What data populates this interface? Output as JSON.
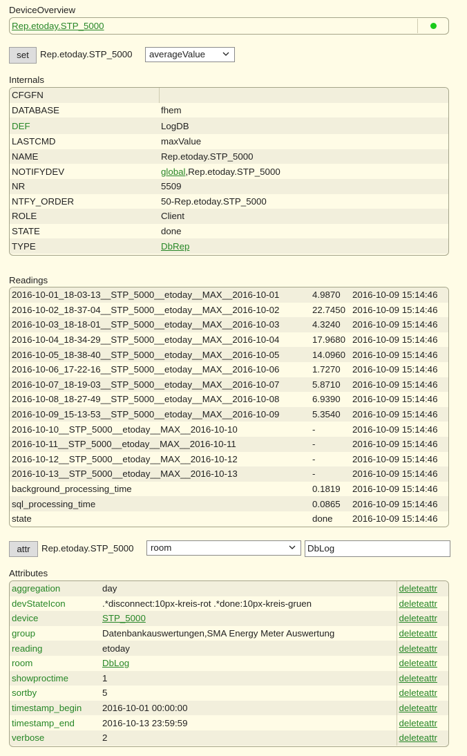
{
  "device_overview": {
    "title": "DeviceOverview",
    "device_link": "Rep.etoday.STP_5000",
    "status_color": "#1aca1a"
  },
  "set_row": {
    "button_label": "set",
    "device_name": "Rep.etoday.STP_5000",
    "selected_value": "averageValue"
  },
  "internals": {
    "title": "Internals",
    "rows": [
      {
        "key": "CFGFN",
        "value": ""
      },
      {
        "key": "DATABASE",
        "value": "fhem"
      },
      {
        "key": "DEF",
        "value": "LogDB"
      },
      {
        "key": "LASTCMD",
        "value": "maxValue"
      },
      {
        "key": "NAME",
        "value": "Rep.etoday.STP_5000"
      },
      {
        "key": "NOTIFYDEV",
        "value_link": "global",
        "value_rest": ",Rep.etoday.STP_5000"
      },
      {
        "key": "NR",
        "value": "5509"
      },
      {
        "key": "NTFY_ORDER",
        "value": "50-Rep.etoday.STP_5000"
      },
      {
        "key": "ROLE",
        "value": "Client"
      },
      {
        "key": "STATE",
        "value": "done"
      },
      {
        "key": "TYPE",
        "value_link": "DbRep"
      }
    ]
  },
  "readings": {
    "title": "Readings",
    "rows": [
      {
        "name": "2016-10-01_18-03-13__STP_5000__etoday__MAX__2016-10-01",
        "value": "4.9870",
        "time": "2016-10-09 15:14:46"
      },
      {
        "name": "2016-10-02_18-37-04__STP_5000__etoday__MAX__2016-10-02",
        "value": "22.7450",
        "time": "2016-10-09 15:14:46"
      },
      {
        "name": "2016-10-03_18-18-01__STP_5000__etoday__MAX__2016-10-03",
        "value": "4.3240",
        "time": "2016-10-09 15:14:46"
      },
      {
        "name": "2016-10-04_18-34-29__STP_5000__etoday__MAX__2016-10-04",
        "value": "17.9680",
        "time": "2016-10-09 15:14:46"
      },
      {
        "name": "2016-10-05_18-38-40__STP_5000__etoday__MAX__2016-10-05",
        "value": "14.0960",
        "time": "2016-10-09 15:14:46"
      },
      {
        "name": "2016-10-06_17-22-16__STP_5000__etoday__MAX__2016-10-06",
        "value": "1.7270",
        "time": "2016-10-09 15:14:46"
      },
      {
        "name": "2016-10-07_18-19-03__STP_5000__etoday__MAX__2016-10-07",
        "value": "5.8710",
        "time": "2016-10-09 15:14:46"
      },
      {
        "name": "2016-10-08_18-27-49__STP_5000__etoday__MAX__2016-10-08",
        "value": "6.9390",
        "time": "2016-10-09 15:14:46"
      },
      {
        "name": "2016-10-09_15-13-53__STP_5000__etoday__MAX__2016-10-09",
        "value": "5.3540",
        "time": "2016-10-09 15:14:46"
      },
      {
        "name": "2016-10-10__STP_5000__etoday__MAX__2016-10-10",
        "value": "-",
        "time": "2016-10-09 15:14:46"
      },
      {
        "name": "2016-10-11__STP_5000__etoday__MAX__2016-10-11",
        "value": "-",
        "time": "2016-10-09 15:14:46"
      },
      {
        "name": "2016-10-12__STP_5000__etoday__MAX__2016-10-12",
        "value": "-",
        "time": "2016-10-09 15:14:46"
      },
      {
        "name": "2016-10-13__STP_5000__etoday__MAX__2016-10-13",
        "value": "-",
        "time": "2016-10-09 15:14:46"
      },
      {
        "name": "background_processing_time",
        "value": "0.1819",
        "time": "2016-10-09 15:14:46"
      },
      {
        "name": "sql_processing_time",
        "value": "0.0865",
        "time": "2016-10-09 15:14:46"
      },
      {
        "name": "state",
        "value": "done",
        "time": "2016-10-09 15:14:46"
      }
    ]
  },
  "attr_row": {
    "button_label": "attr",
    "device_name": "Rep.etoday.STP_5000",
    "selected_attr": "room",
    "input_value": "DbLog"
  },
  "attributes": {
    "title": "Attributes",
    "delete_label": "deleteattr",
    "rows": [
      {
        "name": "aggregation",
        "value": "day"
      },
      {
        "name": "devStateIcon",
        "value": ".*disconnect:10px-kreis-rot .*done:10px-kreis-gruen"
      },
      {
        "name": "device",
        "value_link": "STP_5000"
      },
      {
        "name": "group",
        "value": "Datenbankauswertungen,SMA Energy Meter Auswertung"
      },
      {
        "name": "reading",
        "value": "etoday"
      },
      {
        "name": "room",
        "value_link": "DbLog"
      },
      {
        "name": "showproctime",
        "value": "1"
      },
      {
        "name": "sortby",
        "value": "5"
      },
      {
        "name": "timestamp_begin",
        "value": "2016-10-01 00:00:00"
      },
      {
        "name": "timestamp_end",
        "value": "2016-10-13 23:59:59"
      },
      {
        "name": "verbose",
        "value": "2"
      }
    ]
  }
}
